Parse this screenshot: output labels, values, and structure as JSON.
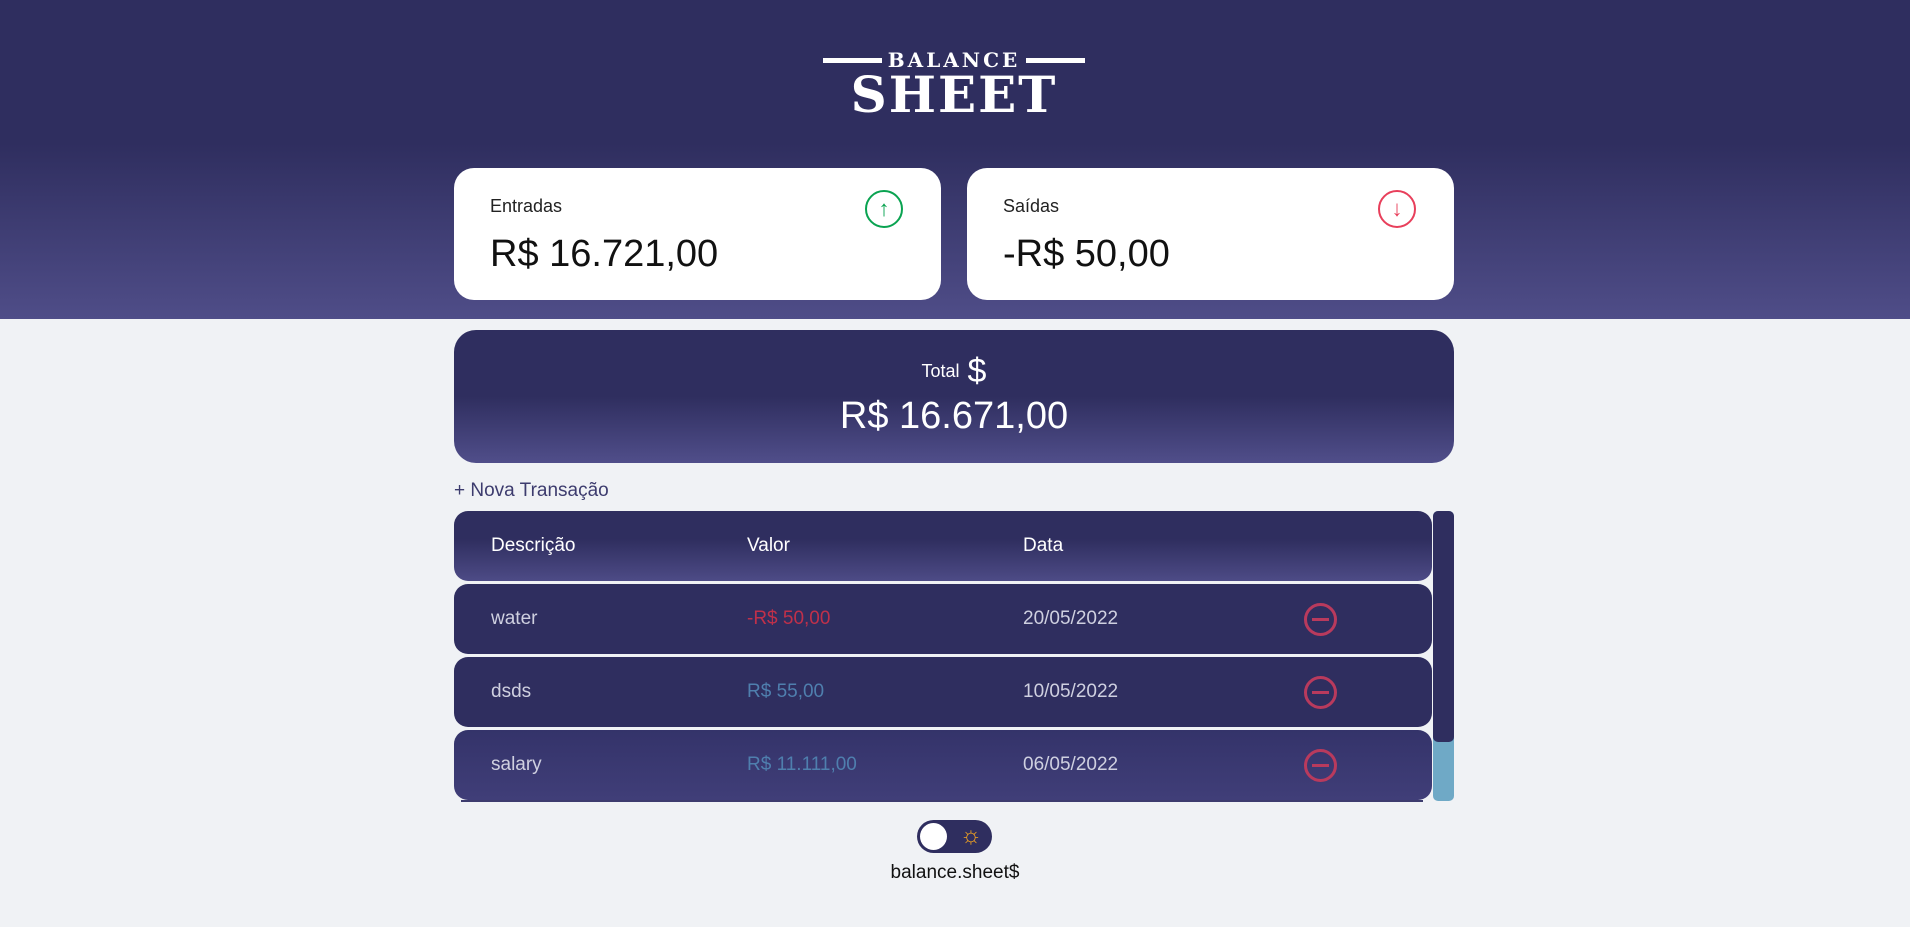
{
  "logo": {
    "line1": "BALANCE",
    "line2": "SHEET"
  },
  "cards": {
    "income": {
      "label": "Entradas",
      "value": "R$ 16.721,00",
      "icon": "arrow-up-circle-icon",
      "color": "#0aa351"
    },
    "expense": {
      "label": "Saídas",
      "value": "-R$ 50,00",
      "icon": "arrow-down-circle-icon",
      "color": "#e83f5b"
    },
    "total": {
      "label": "Total",
      "icon": "$",
      "value": "R$ 16.671,00"
    }
  },
  "new_transaction": "+ Nova Transação",
  "table": {
    "headers": [
      "Descrição",
      "Valor",
      "Data"
    ],
    "rows": [
      {
        "description": "water",
        "value": "-R$ 50,00",
        "date": "20/05/2022",
        "type": "expense"
      },
      {
        "description": "dsds",
        "value": "R$ 55,00",
        "date": "10/05/2022",
        "type": "income"
      },
      {
        "description": "salary",
        "value": "R$ 11.111,00",
        "date": "06/05/2022",
        "type": "income"
      }
    ]
  },
  "colors": {
    "expense": "#c0304a",
    "income": "#4f7fae",
    "primary": "#2f2e5f"
  },
  "theme_toggle": {
    "icon": "☼"
  },
  "footer": "balance.sheet$"
}
